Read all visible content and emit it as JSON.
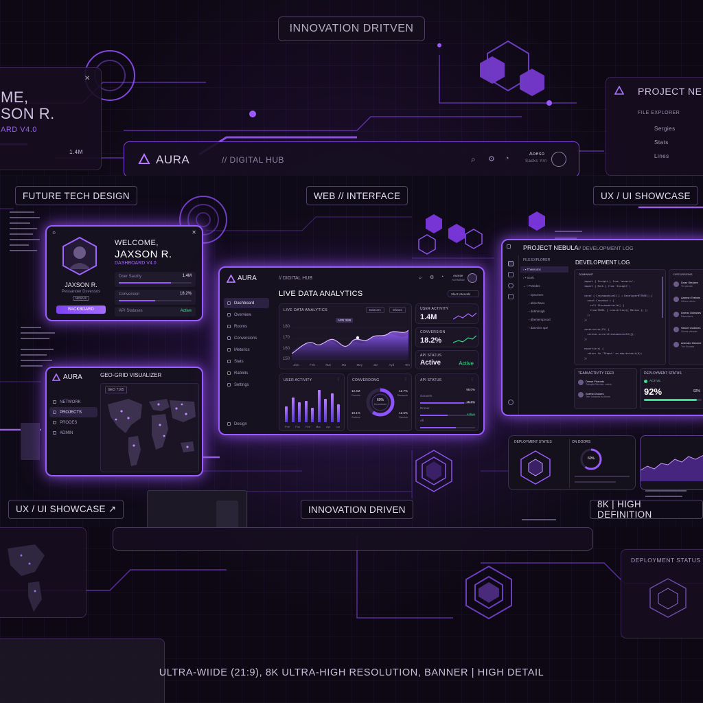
{
  "top_tag": "INNOVATION DRITVEN",
  "bg_left": {
    "line1": "ME,",
    "line2": "SON R.",
    "line3": "ARD V4.0",
    "stat": "1.4M"
  },
  "bg_right": {
    "title": "PROJECT NE",
    "sub": "FILE EXPLORER",
    "items": [
      "Sergies",
      "Stats",
      "Lines"
    ]
  },
  "bg_header": {
    "brand": "AURA",
    "section": "// DIGITAL HUB",
    "user": "Aoeso",
    "user_sub": "Sacks Yrn"
  },
  "pills": {
    "future": "FUTURE TECH DESIGN",
    "web": "WEB // INTERFACE",
    "ux_top": "UX / UI SHOWCASE",
    "ux_bottom": "UX / UI SHOWCASE ↗",
    "innovation": "INNOVATION DRIVEN",
    "hd": "8K | HIGH DEFINITION"
  },
  "welcome": {
    "greeting": "WELCOME,",
    "name": "JAXSON R.",
    "subtitle": "DASHBOARD V4.0",
    "avatar_name": "JAXSON R.",
    "avatar_role": "Pessanoer Dsvessos",
    "badge": "NEBAIS",
    "button": "BACKBOARD",
    "stats": [
      {
        "label": "Doer Sacrity",
        "value": "1.4M",
        "fill": 0.72
      },
      {
        "label": "Conversion",
        "value": "18.2%",
        "fill": 0.5
      },
      {
        "label": "API Statuses",
        "value": "Active",
        "fill": 0
      }
    ]
  },
  "geo": {
    "brand": "AURA",
    "title": "GEO-GRID VISUALIZER",
    "map_label": "GEO 7165",
    "nav": [
      "NETWORK",
      "PROJECTS",
      "PRODES",
      "ADMIN"
    ]
  },
  "dash": {
    "brand": "AURA",
    "section": "// DIGITAL HUB",
    "user": "Aureze",
    "user_sub": "Acesdoar",
    "title": "LIVE DATA ANALYTICS",
    "filter": "Slect Intervals",
    "nav": [
      "Dashboard",
      "Overview",
      "Rooms",
      "Conversions",
      "Metorics",
      "Stats",
      "Rabbits",
      "Settings"
    ],
    "nav_footer": "Design",
    "chart_title": "LIVE DATA ANALYTICS",
    "chart_chip1": "Dancers",
    "chart_chip2": "Shines",
    "chart_tooltip": "APR 3/88",
    "y_ticks": [
      "180",
      "170",
      "160",
      "150"
    ],
    "x_ticks": [
      "Jam",
      "Feb",
      "Mar",
      "Ma",
      "Mey",
      "Jan",
      "Ayd",
      "Ten"
    ],
    "user_activity_label": "USER ACTIVITY",
    "user_activity_value": "1.4M",
    "conversion_label": "CONVERSION",
    "conversion_value": "18.2%",
    "api_label": "API STATUS",
    "api_value": "Active",
    "api_state": "Active",
    "bars_title": "USER ACTIVITY",
    "bar_levels": [
      0.45,
      0.7,
      0.55,
      0.6,
      0.4,
      0.9,
      0.65,
      0.8,
      0.5
    ],
    "bar_labels": [
      "Frm",
      "Fon",
      "Fee",
      "Mar",
      "Apr",
      "Lar"
    ],
    "donut_title": "CONVERDONG",
    "donut_value": "60%",
    "donut_sub": "Coverdoner",
    "donut_fill": 0.6,
    "donut_left": [
      "12.4M",
      "10.1%"
    ],
    "donut_left_sub": [
      "Coccors",
      "Gotores"
    ],
    "donut_right": [
      "12.7%",
      "12.5%"
    ],
    "donut_right_sub": [
      "Denasore",
      "Canetas"
    ],
    "api_status_title": "API STATUS",
    "api_rows": [
      {
        "label": "Gorunes",
        "value": "98.0%",
        "fill": 0.8
      },
      {
        "label": "Droner",
        "value": "16.6%",
        "fill": 0.5
      },
      {
        "label": "Afi",
        "value": "Active",
        "fill": 0.65
      }
    ]
  },
  "nebula": {
    "title": "PROJECT NEBULA",
    "subtitle": "// DEVELOPMENT LOG",
    "explorer": "FILE EXPLORER",
    "files": [
      "Thereoms",
      "Sceb",
      "Prandes",
      "opsorsen",
      "abinchaes",
      "dnkhtrsigh",
      "dheniersproud",
      "darvoiss spe"
    ],
    "log_title": "DEVELOPMENT LOG",
    "code_label": "DOMINANT",
    "code": [
      "import { Insight } from 'anaeris';",
      "import { Bulk } from 'Insight';",
      "",
      "const { CrossmaphiceSI } = DeveloperMTTREE() {",
      "  const Crosshod = {",
      "    cull Stereomatiscle() {",
      "    CrossTRVEL [ crossitlive({ Matiox }) ];",
      "  };",
      "};",
      "",
      "constructor(Sl) {",
      "  ceresis.orrorilloviomencieSJ({};",
      "};",
      "",
      "export(ors) {",
      "  return fa 'Thapst' an deprieisoit(0);",
      "};"
    ],
    "chat_label": "DISCUSSIONS",
    "chat": [
      {
        "name": "Dowr Stecken",
        "msg": "Thi ctenste"
      },
      {
        "name": "Aanesn Teelves",
        "msg": "Cilhoo eeorrs"
      },
      {
        "name": "Unerst Odeanes",
        "msg": "Dsarmtarrs"
      },
      {
        "name": "Stecnt Ocdenes",
        "msg": "Cinnfa sheeder"
      },
      {
        "name": "Anevalo Gesnee",
        "msg": "Toe Dsoasts"
      }
    ],
    "team_title": "TEAM ACTIVITY FEED",
    "team": [
      {
        "name": "Desse Fhaords",
        "msg": "Tobuyitd Serrose, cwtnis"
      },
      {
        "name": "Soerst Doooes",
        "msg": "Teer Iurnsoes ts dhrors"
      }
    ],
    "deploy_title": "DEPLOYMENT STATUS",
    "deploy_state": "ACTIVE",
    "deploy_value": "92%",
    "deploy_value_right": "92%",
    "deploy_fill": 0.92
  },
  "mini": {
    "left_title": "DEPLOYMENT STATUS",
    "mid_title": "ON DOORS",
    "mid_value": "60%"
  },
  "lower_right": {
    "title": "DEPLOYMENT STATUS"
  },
  "bottom_caption": "ULTRA-WIIDE (21:9), 8K ULTRA-HIGH RESOLUTION, BANNER | HIGH DETAIL"
}
